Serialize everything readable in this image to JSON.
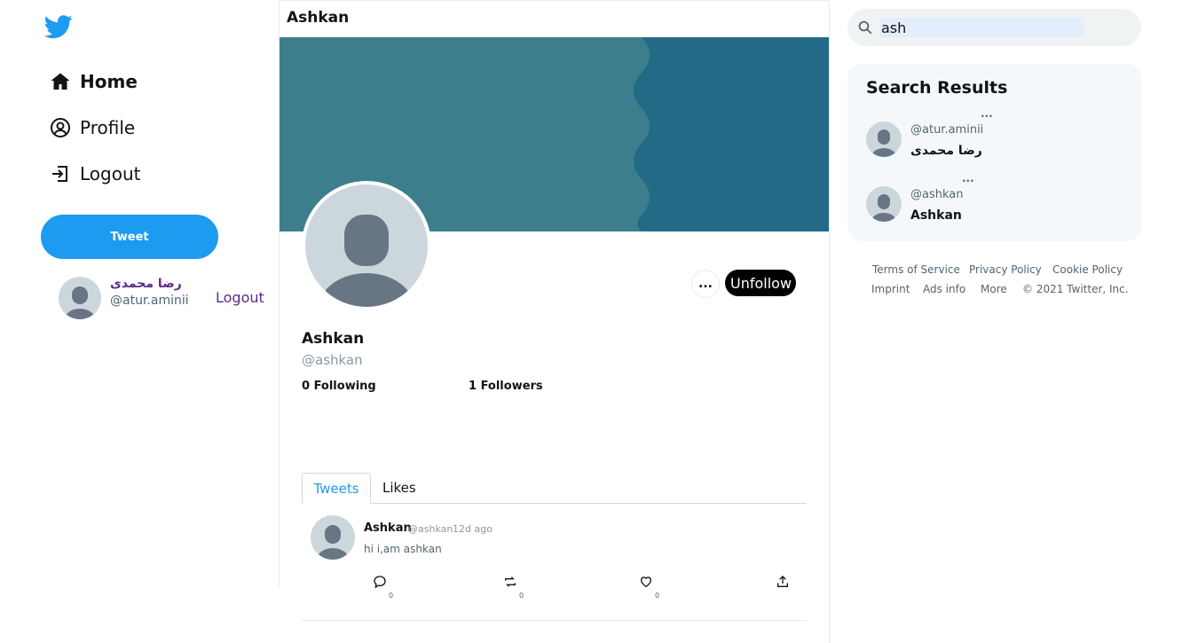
{
  "colors": {
    "brand": "#1d9bf0",
    "accent_purple": "#5b2a86",
    "banner_light": "#3d7e8c",
    "banner_dark": "#236a86"
  },
  "sidebar": {
    "logo": "twitter-bird-icon",
    "items": [
      {
        "label": "Home",
        "icon": "home-icon"
      },
      {
        "label": "Profile",
        "icon": "user-circle-icon"
      },
      {
        "label": "Logout",
        "icon": "logout-icon"
      }
    ],
    "tweet_button": "Tweet",
    "user": {
      "name": "رضا محمدی",
      "handle": "@atur.aminii",
      "logout_label": "Logout"
    }
  },
  "header": {
    "title": "Ashkan"
  },
  "profile": {
    "name": "Ashkan",
    "handle": "@ashkan",
    "more_label": "...",
    "unfollow_label": "Unfollow",
    "following": "0 Following",
    "followers": "1 Followers"
  },
  "tabs": [
    {
      "label": "Tweets",
      "active": true
    },
    {
      "label": "Likes",
      "active": false
    }
  ],
  "tweets": [
    {
      "author": "Ashkan",
      "handle": "@ashkan",
      "time": "12d ago",
      "text": "hi i,am ashkan",
      "replies": "0",
      "retweets": "0",
      "likes": "0"
    }
  ],
  "search": {
    "value": "ash",
    "icon": "search-icon"
  },
  "results": {
    "title": "Search Results",
    "items": [
      {
        "handle": "@atur.aminii",
        "name": "رضا محمدی",
        "more": "..."
      },
      {
        "handle": "@ashkan",
        "name": "Ashkan",
        "more": "..."
      }
    ]
  },
  "footer": {
    "links": [
      "Terms of Service",
      "Privacy Policy",
      "Cookie Policy",
      "Imprint",
      "Ads info",
      "More"
    ],
    "copyright": "© 2021 Twitter, Inc."
  }
}
